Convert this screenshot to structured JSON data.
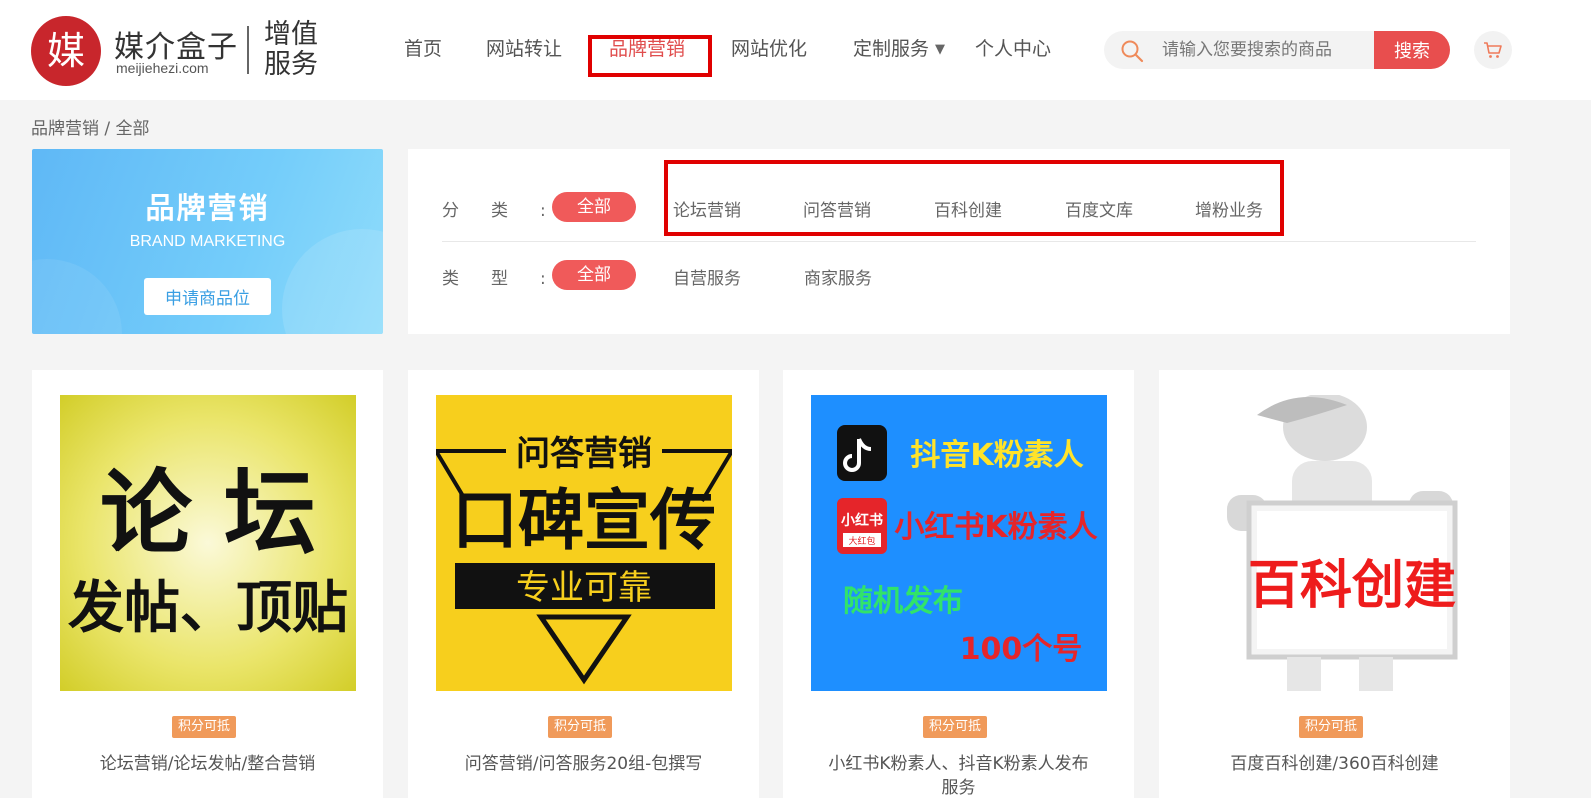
{
  "header": {
    "logo_char": "媒",
    "logo_name": "媒介盒子",
    "logo_domain": "meijiehezi.com",
    "logo_tag": "增值服务",
    "nav": [
      {
        "label": "首页"
      },
      {
        "label": "网站转让"
      },
      {
        "label": "品牌营销",
        "active": true
      },
      {
        "label": "网站优化"
      },
      {
        "label": "定制服务",
        "caret": "▼"
      },
      {
        "label": "个人中心"
      }
    ],
    "search": {
      "placeholder": "请输入您要搜索的商品",
      "button": "搜索",
      "icon": "search-icon"
    },
    "cart_icon": "cart-icon",
    "accent_color": "#e84e4e"
  },
  "breadcrumb": "品牌营销 / 全部",
  "banner": {
    "title": "品牌营销",
    "subtitle": "BRAND MARKETING",
    "button": "申请商品位"
  },
  "filter": {
    "category_label": "分类",
    "type_label": "类型",
    "colon": ":",
    "categories": [
      "全部",
      "论坛营销",
      "问答营销",
      "百科创建",
      "百度文库",
      "增粉业务"
    ],
    "types": [
      "全部",
      "自营服务",
      "商家服务"
    ]
  },
  "products": [
    {
      "badge": "积分可抵",
      "title": "论坛营销/论坛发帖/整合营销",
      "image_text": [
        "论 坛",
        "发帖、顶贴"
      ]
    },
    {
      "badge": "积分可抵",
      "title": "问答营销/问答服务20组-包撰写",
      "image_text": [
        "问答营销",
        "口碑宣传",
        "专业可靠"
      ]
    },
    {
      "badge": "积分可抵",
      "title": "小红书K粉素人、抖音K粉素人发布服务",
      "image_text": [
        "抖音K粉素人",
        "小红书K粉素人",
        "随机发布",
        "100个号",
        "小红书",
        "大红包"
      ]
    },
    {
      "badge": "积分可抵",
      "title": "百度百科创建/360百科创建",
      "image_text": [
        "百科创建"
      ]
    }
  ]
}
